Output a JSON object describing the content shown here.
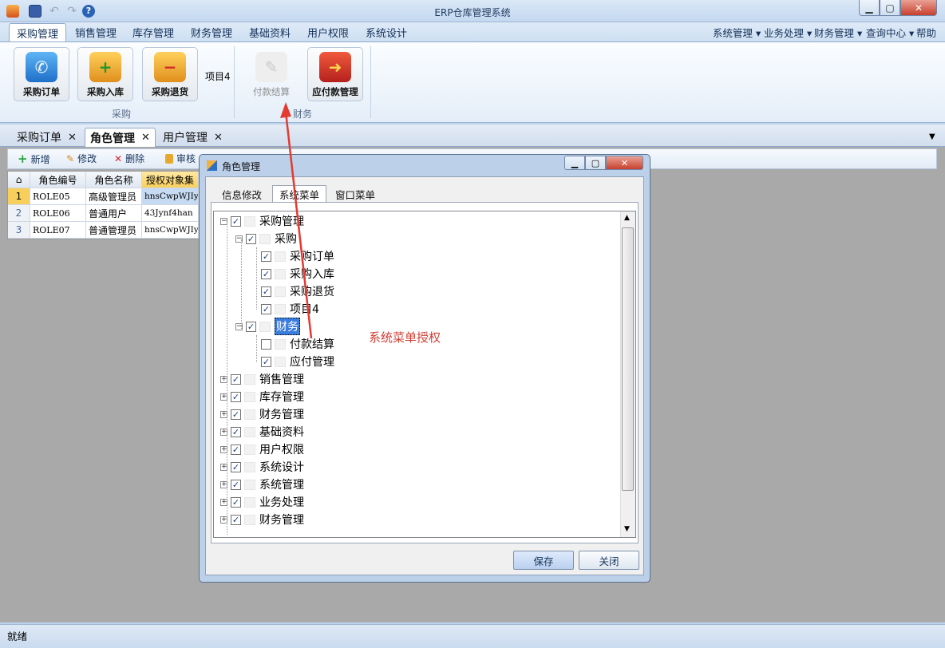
{
  "app": {
    "title": "ERP仓库管理系统"
  },
  "menu_tabs": [
    {
      "label": "采购管理",
      "active": true
    },
    {
      "label": "销售管理"
    },
    {
      "label": "库存管理"
    },
    {
      "label": "财务管理"
    },
    {
      "label": "基础资料"
    },
    {
      "label": "用户权限"
    },
    {
      "label": "系统设计"
    }
  ],
  "right_menus": [
    "系统管理 ▾",
    "业务处理 ▾",
    "财务管理 ▾",
    "查询中心 ▾",
    "帮助"
  ],
  "ribbon": {
    "buttons": [
      {
        "label": "采购订单"
      },
      {
        "label": "采购入库"
      },
      {
        "label": "采购退货"
      }
    ],
    "item4_label": "项目4",
    "finance_buttons": [
      {
        "label": "付款结算",
        "disabled": true
      },
      {
        "label": "应付款管理"
      }
    ],
    "group_labels": [
      "采购",
      "财务"
    ]
  },
  "doc_tabs": [
    {
      "label": "采购订单"
    },
    {
      "label": "角色管理",
      "active": true
    },
    {
      "label": "用户管理"
    }
  ],
  "toolbar": {
    "new": "新增",
    "edit": "修改",
    "delete": "删除",
    "audit": "审核"
  },
  "grid": {
    "columns": [
      "角色编号",
      "角色名称",
      "授权对象集"
    ],
    "rows": [
      {
        "num": "1",
        "code": "ROLE05",
        "name": "高级管理员",
        "auth": "hnsCwpWJIy"
      },
      {
        "num": "2",
        "code": "ROLE06",
        "name": "普通用户",
        "auth": "43Jynf4han"
      },
      {
        "num": "3",
        "code": "ROLE07",
        "name": "普通管理员",
        "auth": "hnsCwpWJIy"
      }
    ]
  },
  "status": {
    "text": "就绪"
  },
  "dialog": {
    "title": "角色管理",
    "tabs": [
      "信息修改",
      "系统菜单",
      "窗口菜单"
    ],
    "active_tab": "系统菜单",
    "tree": [
      {
        "label": "采购管理",
        "level": 0,
        "expanded": true,
        "checked": true
      },
      {
        "label": "采购",
        "level": 1,
        "expanded": true,
        "checked": true
      },
      {
        "label": "采购订单",
        "level": 2,
        "checked": true
      },
      {
        "label": "采购入库",
        "level": 2,
        "checked": true
      },
      {
        "label": "采购退货",
        "level": 2,
        "checked": true
      },
      {
        "label": "项目4",
        "level": 2,
        "checked": true
      },
      {
        "label": "财务",
        "level": 1,
        "expanded": true,
        "checked": true,
        "selected": true
      },
      {
        "label": "付款结算",
        "level": 2,
        "checked": false
      },
      {
        "label": "应付管理",
        "level": 2,
        "checked": true
      },
      {
        "label": "销售管理",
        "level": 0,
        "expanded": false,
        "checked": true
      },
      {
        "label": "库存管理",
        "level": 0,
        "expanded": false,
        "checked": true
      },
      {
        "label": "财务管理",
        "level": 0,
        "expanded": false,
        "checked": true
      },
      {
        "label": "基础资料",
        "level": 0,
        "expanded": false,
        "checked": true
      },
      {
        "label": "用户权限",
        "level": 0,
        "expanded": false,
        "checked": true
      },
      {
        "label": "系统设计",
        "level": 0,
        "expanded": false,
        "checked": true
      },
      {
        "label": "系统管理",
        "level": 0,
        "expanded": false,
        "checked": true
      },
      {
        "label": "业务处理",
        "level": 0,
        "expanded": false,
        "checked": true
      },
      {
        "label": "财务管理",
        "level": 0,
        "expanded": false,
        "checked": true
      }
    ],
    "save_label": "保存",
    "close_label": "关闭"
  },
  "annotation": {
    "text": "系统菜单授权",
    "color": "#d03f36"
  }
}
